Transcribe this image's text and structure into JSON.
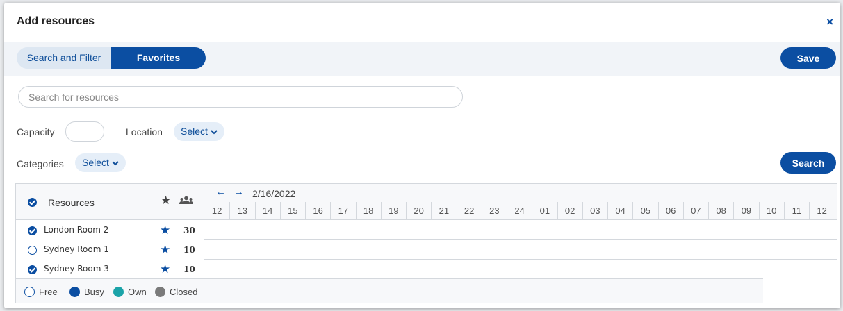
{
  "dialog": {
    "title": "Add resources",
    "close_glyph": "×"
  },
  "tabs": [
    {
      "label": "Search and Filter",
      "active": false
    },
    {
      "label": "Favorites",
      "active": true
    }
  ],
  "save_label": "Save",
  "search": {
    "placeholder": "Search for resources",
    "value": ""
  },
  "filters": {
    "capacity_label": "Capacity",
    "capacity_value": "",
    "location_label": "Location",
    "location_value": "Select",
    "categories_label": "Categories",
    "categories_value": "Select"
  },
  "search_button_label": "Search",
  "grid": {
    "resources_header": "Resources",
    "date": "2/16/2022",
    "hours": [
      "12",
      "13",
      "14",
      "15",
      "16",
      "17",
      "18",
      "19",
      "20",
      "21",
      "22",
      "23",
      "24",
      "01",
      "02",
      "03",
      "04",
      "05",
      "06",
      "07",
      "08",
      "09",
      "10",
      "11",
      "12"
    ],
    "rows": [
      {
        "name": "London Room 2",
        "selected": true,
        "capacity": "30"
      },
      {
        "name": "Sydney Room 1",
        "selected": false,
        "capacity": "10"
      },
      {
        "name": "Sydney Room 3",
        "selected": true,
        "capacity": "10"
      }
    ]
  },
  "legend": [
    {
      "label": "Free",
      "color": "#ffffff",
      "border": "#0b4ea2"
    },
    {
      "label": "Busy",
      "color": "#0b4ea2"
    },
    {
      "label": "Own",
      "color": "#1ba3a8"
    },
    {
      "label": "Closed",
      "color": "#7a7a7a"
    }
  ],
  "colors": {
    "accent": "#0b4ea2",
    "tab_inactive": "#dde7f2",
    "band": "#f1f4f8"
  }
}
